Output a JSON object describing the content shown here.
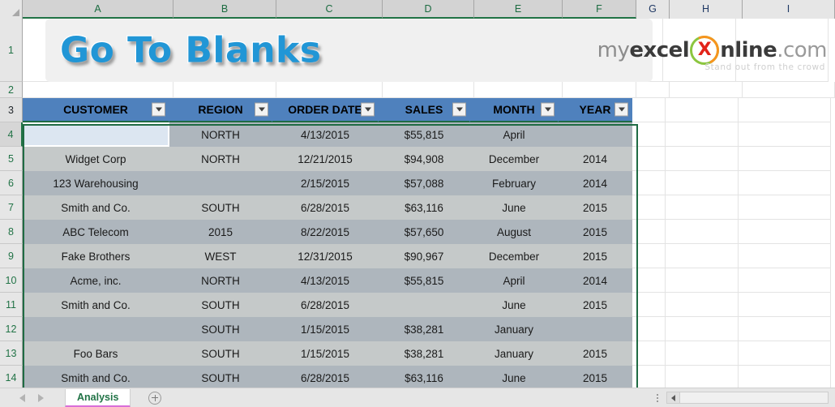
{
  "window": {
    "title": "Go To Blanks"
  },
  "columns": {
    "letters": [
      "A",
      "B",
      "C",
      "D",
      "E",
      "F",
      "G",
      "H",
      "I"
    ],
    "widths": [
      186,
      127,
      131,
      113,
      109,
      91,
      41,
      90,
      114
    ],
    "selected": [
      "A",
      "B",
      "C",
      "D",
      "E",
      "F"
    ]
  },
  "rows": {
    "numbers": [
      "1",
      "2",
      "3",
      "4",
      "5",
      "6",
      "7",
      "8",
      "9",
      "10",
      "11",
      "12",
      "13",
      "14"
    ],
    "heights": [
      78,
      20,
      30,
      30,
      30,
      30,
      30,
      30,
      30,
      30,
      30,
      30,
      30,
      30
    ],
    "active": "4"
  },
  "logo": {
    "my": "my",
    "excel": "excel",
    "mark_left": "X",
    "online": "nline",
    "com": ".com",
    "tagline": "Stand out from the crowd"
  },
  "table": {
    "headers": [
      "CUSTOMER",
      "REGION",
      "ORDER DATE",
      "SALES",
      "MONTH",
      "YEAR"
    ],
    "filter_icon": "filter-dropdown-icon",
    "rows": [
      {
        "row": "4",
        "cells": [
          "",
          "NORTH",
          "4/13/2015",
          "$55,815",
          "April",
          ""
        ]
      },
      {
        "row": "5",
        "cells": [
          "Widget Corp",
          "NORTH",
          "12/21/2015",
          "$94,908",
          "December",
          "2014"
        ]
      },
      {
        "row": "6",
        "cells": [
          "123 Warehousing",
          "",
          "2/15/2015",
          "$57,088",
          "February",
          "2014"
        ]
      },
      {
        "row": "7",
        "cells": [
          "Smith and Co.",
          "SOUTH",
          "6/28/2015",
          "$63,116",
          "June",
          "2015"
        ]
      },
      {
        "row": "8",
        "cells": [
          "ABC Telecom",
          "2015",
          "8/22/2015",
          "$57,650",
          "August",
          "2015"
        ]
      },
      {
        "row": "9",
        "cells": [
          "Fake Brothers",
          "WEST",
          "12/31/2015",
          "$90,967",
          "December",
          "2015"
        ]
      },
      {
        "row": "10",
        "cells": [
          "Acme, inc.",
          "NORTH",
          "4/13/2015",
          "$55,815",
          "April",
          "2014"
        ]
      },
      {
        "row": "11",
        "cells": [
          "Smith and Co.",
          "SOUTH",
          "6/28/2015",
          "",
          "June",
          "2015"
        ]
      },
      {
        "row": "12",
        "cells": [
          "",
          "SOUTH",
          "1/15/2015",
          "$38,281",
          "January",
          ""
        ]
      },
      {
        "row": "13",
        "cells": [
          "Foo Bars",
          "SOUTH",
          "1/15/2015",
          "$38,281",
          "January",
          "2015"
        ]
      },
      {
        "row": "14",
        "cells": [
          "Smith and Co.",
          "SOUTH",
          "6/28/2015",
          "$63,116",
          "June",
          "2015"
        ]
      }
    ]
  },
  "sheet_tabs": {
    "active": "Analysis",
    "prev_icon": "arrow-left-icon",
    "next_icon": "arrow-right-icon",
    "add_icon": "plus-icon"
  },
  "colors": {
    "header_fill": "#4f81bd",
    "table_border": "#1f6b43",
    "band_light": "#c5c9c9",
    "band_dark": "#aeb6bd",
    "selection": "#dce6f1",
    "tab_accent": "#d96fd9",
    "title_blue": "#2196d6"
  }
}
